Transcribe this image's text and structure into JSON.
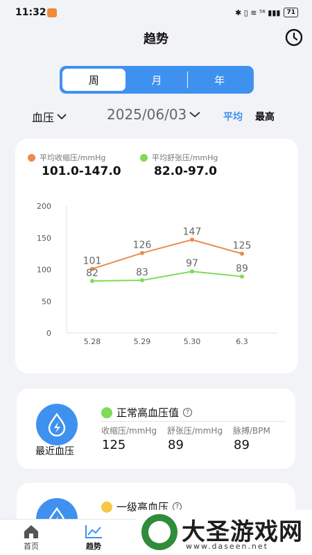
{
  "status_bar": {
    "time": "11:32",
    "right_text": "✱ ▯ ≋ ⁵⁶ ▮▮▮",
    "battery": "71"
  },
  "header": {
    "title": "趋势",
    "history_icon": "clock-icon"
  },
  "period_tabs": [
    {
      "label": "周",
      "active": true
    },
    {
      "label": "月",
      "active": false
    },
    {
      "label": "年",
      "active": false
    }
  ],
  "filters": {
    "metric": "血压",
    "date": "2025/06/03",
    "mode_avg": "平均",
    "mode_max": "最高"
  },
  "chart_card": {
    "systolic_legend": "平均收缩压/mmHg",
    "diastolic_legend": "平均舒张压/mmHg",
    "systolic_range": "101.0-147.0",
    "diastolic_range": "82.0-97.0",
    "colors": {
      "systolic": "#ec8a4f",
      "diastolic": "#7ddb58"
    }
  },
  "chart_data": {
    "type": "line",
    "x": [
      "5.28",
      "5.29",
      "5.30",
      "6.3"
    ],
    "series": [
      {
        "name": "平均收缩压/mmHg",
        "values": [
          101,
          126,
          147,
          125
        ],
        "color": "#ec8a4f"
      },
      {
        "name": "平均舒张压/mmHg",
        "values": [
          82,
          83,
          97,
          89
        ],
        "color": "#7ddb58"
      }
    ],
    "yticks": [
      "0",
      "50",
      "100",
      "150",
      "200"
    ],
    "ylim": [
      0,
      200
    ],
    "grid": false
  },
  "latest_card": {
    "label": "最近血压",
    "status": "正常高血压值",
    "status_color": "#7ddb58",
    "col_labels": [
      "收缩压/mmHg",
      "舒张压/mmHg",
      "脉搏/BPM"
    ],
    "col_values": [
      "125",
      "89",
      "89"
    ]
  },
  "second_card": {
    "status": "一级高血压",
    "status_color": "#f5c842"
  },
  "bottom_nav": [
    {
      "label": "首页",
      "icon": "home-icon",
      "active": false
    },
    {
      "label": "趋势",
      "icon": "trend-icon",
      "active": true
    }
  ],
  "watermark": {
    "title": "大圣游戏网",
    "url": "www.daseen.net"
  }
}
